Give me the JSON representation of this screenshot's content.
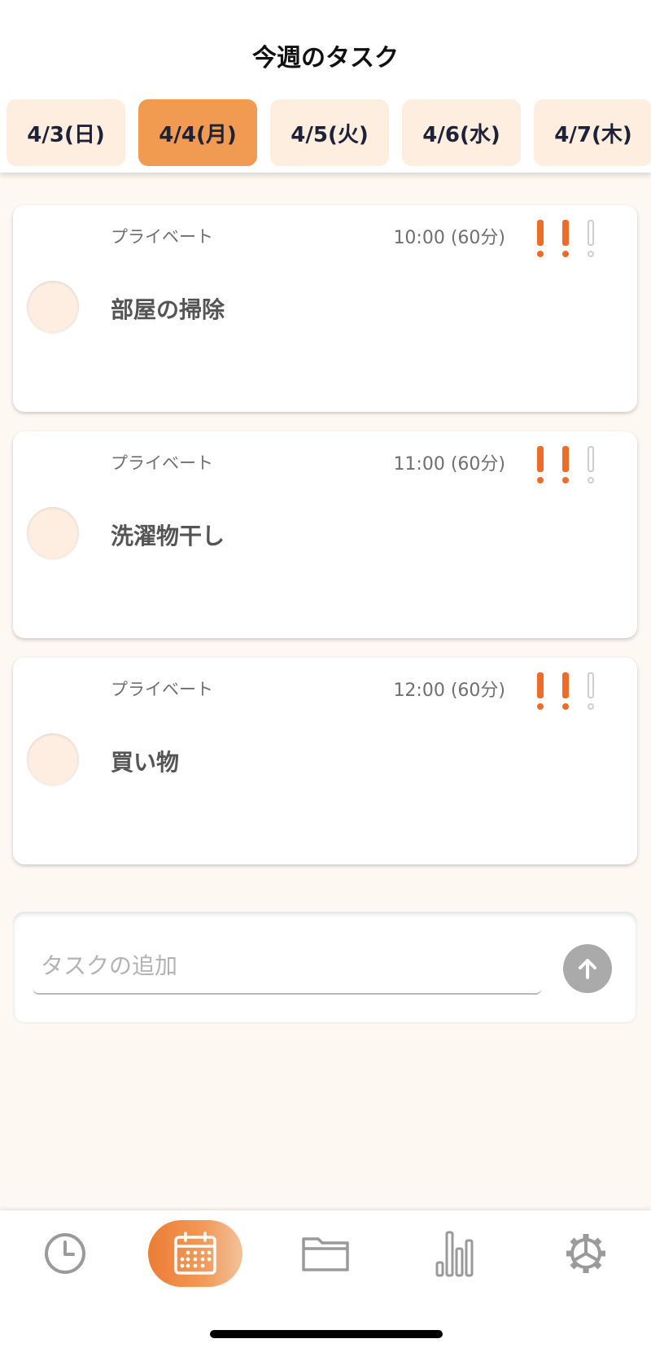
{
  "header": {
    "title": "今週のタスク"
  },
  "dates": [
    {
      "label": "4/3(日)",
      "active": false
    },
    {
      "label": "4/4(月)",
      "active": true
    },
    {
      "label": "4/5(火)",
      "active": false
    },
    {
      "label": "4/6(水)",
      "active": false
    },
    {
      "label": "4/7(木)",
      "active": false
    }
  ],
  "tasks": [
    {
      "category": "プライベート",
      "time": "10:00 (60分)",
      "name": "部屋の掃除",
      "priority": 2,
      "priority_max": 3,
      "done": false
    },
    {
      "category": "プライベート",
      "time": "11:00 (60分)",
      "name": "洗濯物干し",
      "priority": 2,
      "priority_max": 3,
      "done": false
    },
    {
      "category": "プライベート",
      "time": "12:00 (60分)",
      "name": "買い物",
      "priority": 2,
      "priority_max": 3,
      "done": false
    }
  ],
  "add_task": {
    "placeholder": "タスクの追加",
    "send_icon": "arrow-up-icon"
  },
  "nav": [
    {
      "icon": "clock-icon",
      "active": false
    },
    {
      "icon": "calendar-icon",
      "active": true
    },
    {
      "icon": "folder-icon",
      "active": false
    },
    {
      "icon": "bar-chart-icon",
      "active": false
    },
    {
      "icon": "gear-icon",
      "active": false
    }
  ],
  "colors": {
    "accent": "#ee6c28",
    "active_tab": "#f19a52",
    "tab_bg": "#fdeee0",
    "page_bg": "#fdf8f2",
    "priority_off": "#cfcfcf"
  }
}
